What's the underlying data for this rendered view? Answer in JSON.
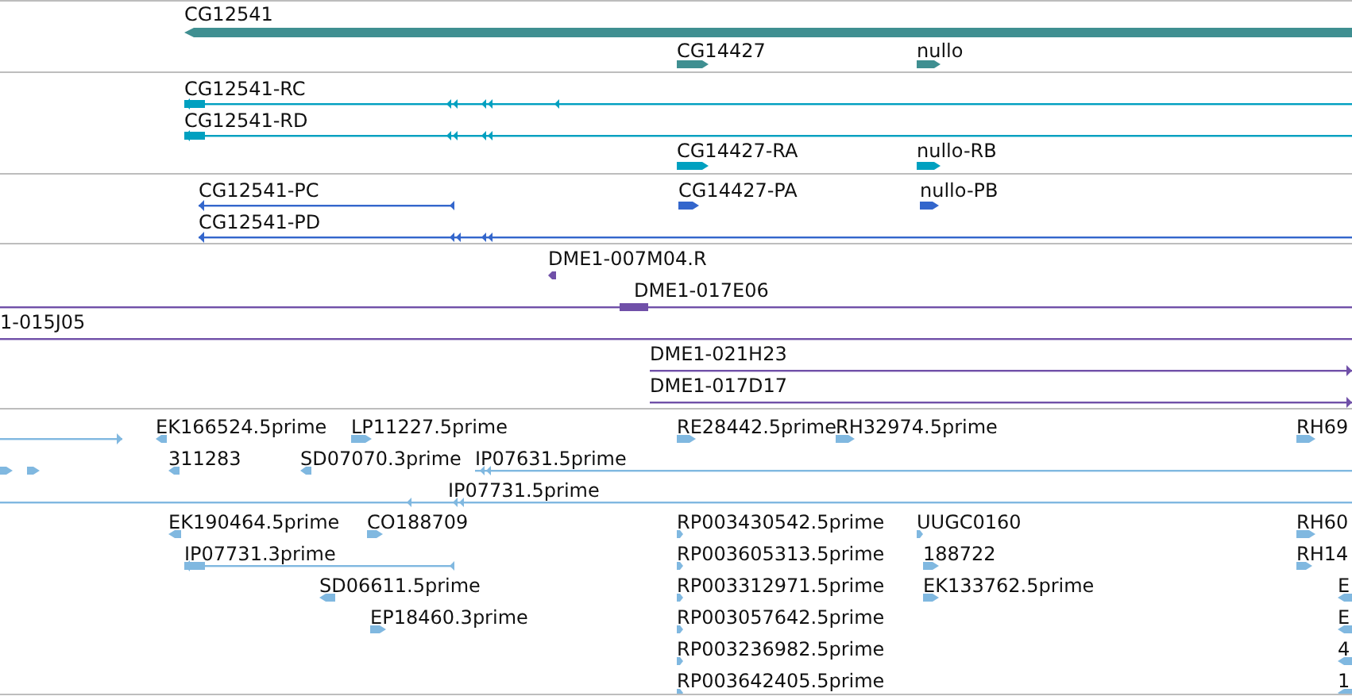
{
  "tracks": [
    {
      "color": "#3f8f91",
      "features": [
        {
          "label": "CG12541",
          "reverse": true
        },
        {
          "label": "CG14427",
          "reverse": false
        },
        {
          "label": "nullo",
          "reverse": false
        }
      ]
    },
    {
      "color": "#00a0c0",
      "features": [
        {
          "label": "CG12541-RC",
          "reverse": true
        },
        {
          "label": "CG12541-RD",
          "reverse": true
        },
        {
          "label": "CG14427-RA",
          "reverse": false
        },
        {
          "label": "nullo-RB",
          "reverse": false
        }
      ]
    },
    {
      "color": "#3366cc",
      "features": [
        {
          "label": "CG12541-PC",
          "reverse": true
        },
        {
          "label": "CG12541-PD",
          "reverse": true
        },
        {
          "label": "CG14427-PA",
          "reverse": false
        },
        {
          "label": "nullo-PB",
          "reverse": false
        }
      ]
    },
    {
      "color": "#7050a8",
      "features": [
        {
          "label": "DME1-007M04.R",
          "reverse": true
        },
        {
          "label": "DME1-017E06"
        },
        {
          "label": "1-015J05"
        },
        {
          "label": "DME1-021H23",
          "reverse": false
        },
        {
          "label": "DME1-017D17",
          "reverse": false
        }
      ]
    },
    {
      "color": "#80b8e0",
      "features": [
        {
          "label": "EK166524.5prime",
          "reverse": true
        },
        {
          "label": "LP11227.5prime",
          "reverse": false
        },
        {
          "label": "RE28442.5prime",
          "reverse": false
        },
        {
          "label": "RH32974.5prime",
          "reverse": false
        },
        {
          "label": "RH69",
          "reverse": false
        },
        {
          "label": "311283",
          "reverse": true
        },
        {
          "label": "SD07070.3prime",
          "reverse": true
        },
        {
          "label": "IP07631.5prime",
          "reverse": true
        },
        {
          "label": "IP07731.5prime",
          "reverse": true
        },
        {
          "label": "EK190464.5prime",
          "reverse": true
        },
        {
          "label": "CO188709",
          "reverse": false
        },
        {
          "label": "RP003430542.5prime",
          "reverse": false
        },
        {
          "label": "UUGC0160",
          "reverse": false
        },
        {
          "label": "RH60",
          "reverse": false
        },
        {
          "label": "IP07731.3prime",
          "reverse": true
        },
        {
          "label": "RP003605313.5prime",
          "reverse": false
        },
        {
          "label": "188722",
          "reverse": false
        },
        {
          "label": "RH14",
          "reverse": false
        },
        {
          "label": "SD06611.5prime",
          "reverse": true
        },
        {
          "label": "RP003312971.5prime",
          "reverse": false
        },
        {
          "label": "EK133762.5prime",
          "reverse": false
        },
        {
          "label": "E",
          "reverse": true
        },
        {
          "label": "EP18460.3prime",
          "reverse": false
        },
        {
          "label": "RP003057642.5prime",
          "reverse": false
        },
        {
          "label": "E",
          "reverse": true
        },
        {
          "label": "RP003236982.5prime",
          "reverse": false
        },
        {
          "label": "4",
          "reverse": true
        },
        {
          "label": "RP003642405.5prime",
          "reverse": false
        },
        {
          "label": "1",
          "reverse": true
        }
      ]
    }
  ]
}
